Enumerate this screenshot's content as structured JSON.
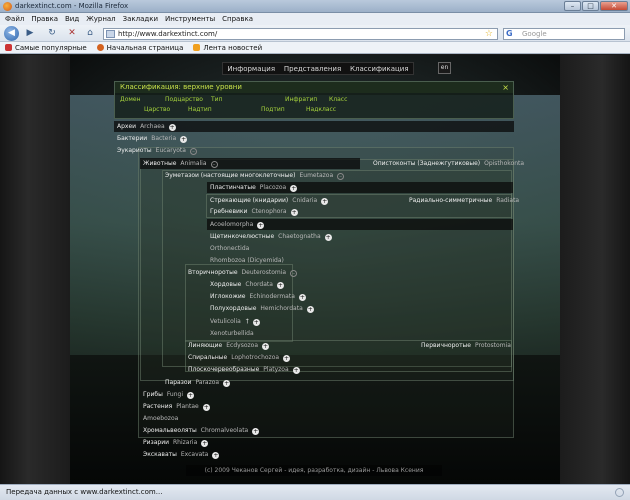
{
  "window": {
    "title": "darkextinct.com - Mozilla Firefox",
    "minimize": "–",
    "maximize": "□",
    "close": "✕"
  },
  "menu": [
    "Файл",
    "Правка",
    "Вид",
    "Журнал",
    "Закладки",
    "Инструменты",
    "Справка"
  ],
  "nav": {
    "url": "http://www.darkextinct.com/",
    "search_placeholder": "Google",
    "back": "◀",
    "forward": "▶",
    "reload": "↻",
    "stop": "✕",
    "home": "⌂",
    "search_engine": "G"
  },
  "bookmarks": [
    {
      "label": "Самые популярные",
      "color": "#c33"
    },
    {
      "label": "Начальная страница",
      "color": "#d4621f"
    },
    {
      "label": "Лента новостей",
      "color": "#f0a020"
    }
  ],
  "status": "Передача данных с www.darkextinct.com...",
  "site_nav": {
    "info": "Информация",
    "views": "Представления",
    "classification": "Классификация",
    "lang": "en"
  },
  "panel": {
    "title": "Классификация: верхние уровни",
    "close": "×",
    "ranks_top": [
      "Домен",
      "Подцарство",
      "Тип",
      "Инфратип",
      "Класс"
    ],
    "ranks_bottom": [
      "Царство",
      "Надтип",
      "Подтип",
      "Надкласс"
    ]
  },
  "tree": {
    "archaea": {
      "ru": "Археи",
      "lat": "Archaea"
    },
    "bacteria": {
      "ru": "Бактерии",
      "lat": "Bacteria"
    },
    "eukaryota": {
      "ru": "Эукариоты",
      "lat": "Eucaryota"
    },
    "animalia": {
      "ru": "Животные",
      "lat": "Animalia"
    },
    "opisthokonta": {
      "ru": "Опистоконты (Заднежгутиковые)",
      "lat": "Opisthokonta"
    },
    "eumetazoa": {
      "ru": "Эуметазои (настоящие многоклеточные)",
      "lat": "Eumetazoa"
    },
    "placozoa": {
      "ru": "Пластинчатые",
      "lat": "Placozoa"
    },
    "cnidaria": {
      "ru": "Стрекающие (книдарии)",
      "lat": "Cnidaria"
    },
    "radiata": {
      "ru": "Радиально-симметричные",
      "lat": "Radiata"
    },
    "ctenophora": {
      "ru": "Гребневики",
      "lat": "Ctenophora"
    },
    "acoelomorpha": {
      "lat": "Acoelomorpha"
    },
    "chaetognatha": {
      "ru": "Щетинкочелюстные",
      "lat": "Chaetognatha"
    },
    "orthonectida": {
      "lat": "Orthonectida"
    },
    "rhombozoa": {
      "lat": "Rhombozoa (Dicyemida)"
    },
    "deuterostomia": {
      "ru": "Вторичноротые",
      "lat": "Deuterostomia"
    },
    "chordata": {
      "ru": "Хордовые",
      "lat": "Chordata"
    },
    "echinodermata": {
      "ru": "Иглокожие",
      "lat": "Echinodermata"
    },
    "hemichordata": {
      "ru": "Полухордовые",
      "lat": "Hemichordata"
    },
    "vetulicolia": {
      "lat": "Vetulicolia",
      "mark": "†"
    },
    "xenoturbellida": {
      "lat": "Xenoturbellida"
    },
    "ecdysozoa": {
      "ru": "Линяющие",
      "lat": "Ecdysozoa"
    },
    "protostomia": {
      "ru": "Первичноротые",
      "lat": "Protostomia"
    },
    "lophotrochozoa": {
      "ru": "Спиральные",
      "lat": "Lophotrochozoa"
    },
    "platyzoa": {
      "ru": "Плоскочервеобразные",
      "lat": "Platyzoa"
    },
    "parazoa": {
      "ru": "Паразои",
      "lat": "Parazoa"
    },
    "fungi": {
      "ru": "Грибы",
      "lat": "Fungi"
    },
    "plantae": {
      "ru": "Растения",
      "lat": "Plantae"
    },
    "amoebozoa": {
      "lat": "Amoebozoa"
    },
    "chromalveolata": {
      "ru": "Хромальвеоляты",
      "lat": "Chromalveolata"
    },
    "rhizaria": {
      "ru": "Ризарии",
      "lat": "Rhizaria"
    },
    "excavata": {
      "ru": "Экскаваты",
      "lat": "Excavata"
    },
    "plus": "+",
    "minus": "–"
  },
  "footer": "(с) 2009 Чеканов Сергей - идея, разработка, дизайн - Львова Ксения"
}
